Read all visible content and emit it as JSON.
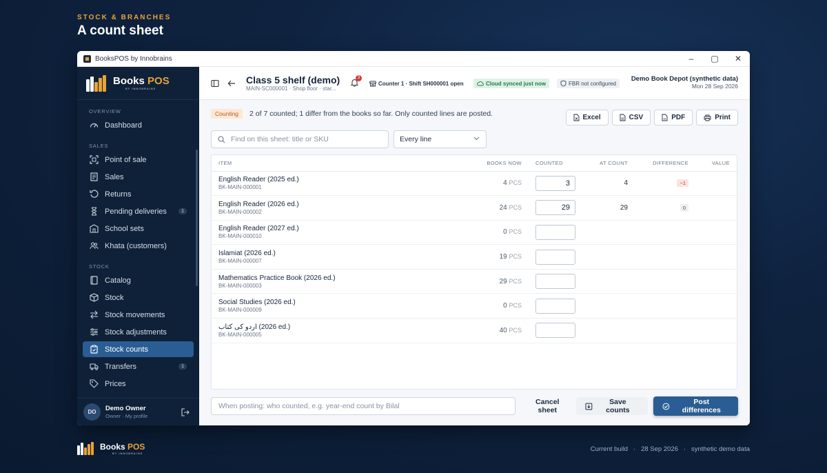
{
  "promo": {
    "kicker": "STOCK & BRANCHES",
    "title": "A count sheet"
  },
  "window": {
    "title": "BooksPOS by Innobrains"
  },
  "brand": {
    "name_a": "Books ",
    "name_b": "POS",
    "sub": "BY INNOBRAINS"
  },
  "sidebar": {
    "sections": {
      "overview": "OVERVIEW",
      "sales": "SALES",
      "stock": "STOCK"
    },
    "items": [
      {
        "label": "Dashboard",
        "icon": "gauge-icon"
      },
      {
        "label": "Point of sale",
        "icon": "scan-icon"
      },
      {
        "label": "Sales",
        "icon": "receipt-icon"
      },
      {
        "label": "Returns",
        "icon": "undo-icon"
      },
      {
        "label": "Pending deliveries",
        "icon": "hourglass-icon",
        "badge": "1"
      },
      {
        "label": "School sets",
        "icon": "school-icon"
      },
      {
        "label": "Khata (customers)",
        "icon": "users-icon"
      },
      {
        "label": "Catalog",
        "icon": "book-icon"
      },
      {
        "label": "Stock",
        "icon": "box-icon"
      },
      {
        "label": "Stock movements",
        "icon": "arrows-icon"
      },
      {
        "label": "Stock adjustments",
        "icon": "sliders-icon"
      },
      {
        "label": "Stock counts",
        "icon": "clipboard-icon",
        "active": true
      },
      {
        "label": "Transfers",
        "icon": "truck-icon",
        "badge": "1"
      },
      {
        "label": "Prices",
        "icon": "tag-icon"
      }
    ],
    "user": {
      "initials": "DO",
      "name": "Demo Owner",
      "sub": "Owner · My profile"
    }
  },
  "topbar": {
    "title": "Class 5 shelf (demo)",
    "subtitle": "MAIN-SC000001 · Shop floor · star...",
    "notifications": "3",
    "counter": "Counter 1 · Shift SH000001 open",
    "sync": "Cloud synced just now",
    "fbr": "FBR not configured",
    "store": "Demo Book Depot (synthetic data)",
    "date": "Mon 28 Sep 2026"
  },
  "status": {
    "pill": "Counting",
    "text": "2 of 7 counted; 1 differ from the books so far. Only counted lines are posted."
  },
  "exports": {
    "excel": "Excel",
    "csv": "CSV",
    "pdf": "PDF",
    "print": "Print"
  },
  "filters": {
    "search_placeholder": "Find on this sheet: title or SKU",
    "scope": "Every line"
  },
  "table": {
    "headers": {
      "item": "ITEM",
      "books_now": "BOOKS NOW",
      "counted": "COUNTED",
      "at_count": "AT COUNT",
      "difference": "DIFFERENCE",
      "value": "VALUE"
    },
    "unit": "PCS",
    "rows": [
      {
        "title": "English Reader (2025 ed.)",
        "sku": "BK-MAIN-000001",
        "now": "4",
        "counted": "3",
        "at_count": "4",
        "diff": "−1",
        "diff_type": "neg"
      },
      {
        "title": "English Reader (2026 ed.)",
        "sku": "BK-MAIN-000002",
        "now": "24",
        "counted": "29",
        "at_count": "29",
        "diff": "0",
        "diff_type": "zero"
      },
      {
        "title": "English Reader (2027 ed.)",
        "sku": "BK-MAIN-000010",
        "now": "0",
        "counted": "",
        "at_count": "",
        "diff": ""
      },
      {
        "title": "Islamiat (2026 ed.)",
        "sku": "BK-MAIN-000007",
        "now": "19",
        "counted": "",
        "at_count": "",
        "diff": ""
      },
      {
        "title": "Mathematics Practice Book (2026 ed.)",
        "sku": "BK-MAIN-000003",
        "now": "29",
        "counted": "",
        "at_count": "",
        "diff": ""
      },
      {
        "title": "Social Studies (2026 ed.)",
        "sku": "BK-MAIN-000009",
        "now": "0",
        "counted": "",
        "at_count": "",
        "diff": ""
      },
      {
        "title": "اردو کی کتاب (2026 ed.)",
        "sku": "BK-MAIN-000005",
        "now": "40",
        "counted": "",
        "at_count": "",
        "diff": ""
      }
    ]
  },
  "footer": {
    "note_placeholder": "When posting: who counted, e.g. year-end count by Bilal",
    "cancel": "Cancel sheet",
    "save": "Save counts",
    "post": "Post differences"
  },
  "bottom": {
    "meta": "Current build   ·   28 Sep 2026   ·   synthetic demo data"
  },
  "colors": {
    "accent": "#2a5d93",
    "brand_gold": "#e9a23b",
    "sidebar_bg": "#0f2138"
  }
}
